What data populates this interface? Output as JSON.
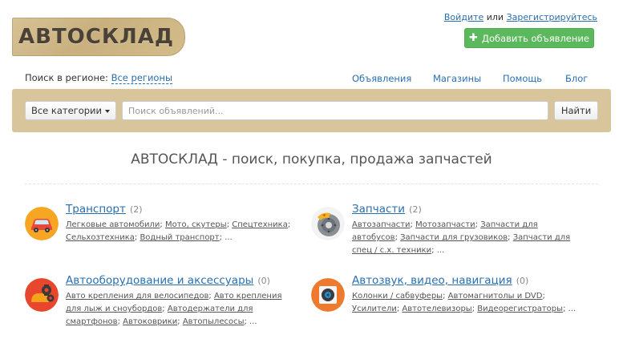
{
  "logo": {
    "text": "АВТОСКЛАД"
  },
  "auth": {
    "login": "Войдите",
    "or": "или",
    "register": "Зарегистрируйтесь"
  },
  "add_button": {
    "icon": "plus-icon",
    "label": "Добавить объявление"
  },
  "region": {
    "label": "Поиск в регионе:",
    "value": "Все регионы"
  },
  "nav": [
    "Объявления",
    "Магазины",
    "Помощь",
    "Блог"
  ],
  "search": {
    "category_label": "Все категории",
    "placeholder": "Поиск объявлений...",
    "button": "Найти"
  },
  "heading": "АВТОСКЛАД - поиск, покупка, продажа запчастей",
  "categories": [
    {
      "title": "Транспорт",
      "count": "(2)",
      "icon": "car-icon",
      "subs": [
        "Легковые автомобили",
        "Мото, скутеры",
        "Спецтехника",
        "Сельхозтехника",
        "Водный транспорт"
      ],
      "more": "..."
    },
    {
      "title": "Запчасти",
      "count": "(2)",
      "icon": "brake-disc-icon",
      "subs": [
        "Автозапчасти",
        "Мотозапчасти",
        "Запчасти для автобусов",
        "Запчасти для грузовиков",
        "Запчасти для спец / с.х. техники"
      ],
      "more": "..."
    },
    {
      "title": "Автооборудование и аксессуары",
      "count": "(0)",
      "icon": "gears-icon",
      "subs": [
        "Авто крепления для велосипедов",
        "Авто крепления для лыж и сноубордов",
        "Автодержатели для смартфонов",
        "Автоковрики",
        "Автопылесосы"
      ],
      "more": "..."
    },
    {
      "title": "Автозвук, видео, навигация",
      "count": "(0)",
      "icon": "speaker-icon",
      "subs": [
        "Колонки / сабвуферы",
        "Автомагнитолы и DVD",
        "Усилители",
        "Автотелевизоры",
        "Видеорегистраторы"
      ],
      "more": "..."
    }
  ],
  "colors": {
    "link": "#2a6fb0",
    "accent_green": "#5cb85c",
    "band": "#d9c59b"
  }
}
